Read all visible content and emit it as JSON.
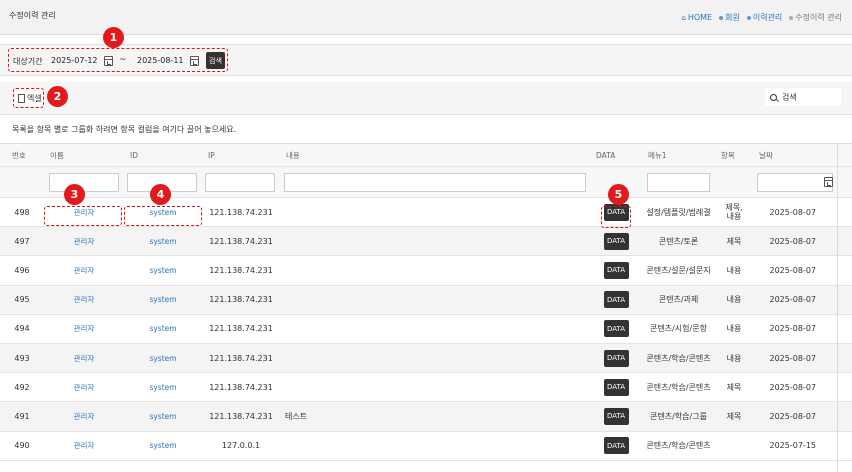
{
  "header": {
    "title": "수정이력 관리",
    "breadcrumb": [
      "HOME",
      "회원",
      "이력관리",
      "수정이력 관리"
    ]
  },
  "filter": {
    "period_label": "대상기간",
    "start_date": "2025-07-12",
    "separator": "~",
    "end_date": "2025-08-11",
    "search_label": "검색"
  },
  "toolbar": {
    "excel_label": "엑셀",
    "search_label": "검색"
  },
  "group_hint": "목록을 항목 별로 그룹화 하려면 항목 컬럼을 여기다 끌어 놓으세요.",
  "grid": {
    "headers": [
      "번호",
      "이름",
      "ID",
      "IP",
      "내용",
      "DATA",
      "메뉴1",
      "항목",
      "날짜"
    ],
    "rows": [
      {
        "no": "498",
        "name": "관리자",
        "id": "system",
        "ip": "121.138.74.231",
        "content": "",
        "data": "DATA",
        "menu": "설정/템플릿/범례결",
        "item": "제목, 내용",
        "date": "2025-08-07"
      },
      {
        "no": "497",
        "name": "관리자",
        "id": "system",
        "ip": "121.138.74.231",
        "content": "",
        "data": "DATA",
        "menu": "콘텐츠/토론",
        "item": "제목",
        "date": "2025-08-07"
      },
      {
        "no": "496",
        "name": "관리자",
        "id": "system",
        "ip": "121.138.74.231",
        "content": "",
        "data": "DATA",
        "menu": "콘텐츠/설문/설문지",
        "item": "내용",
        "date": "2025-08-07"
      },
      {
        "no": "495",
        "name": "관리자",
        "id": "system",
        "ip": "121.138.74.231",
        "content": "",
        "data": "DATA",
        "menu": "콘텐츠/과제",
        "item": "내용",
        "date": "2025-08-07"
      },
      {
        "no": "494",
        "name": "관리자",
        "id": "system",
        "ip": "121.138.74.231",
        "content": "",
        "data": "DATA",
        "menu": "콘텐츠/시험/문항",
        "item": "내용",
        "date": "2025-08-07"
      },
      {
        "no": "493",
        "name": "관리자",
        "id": "system",
        "ip": "121.138.74.231",
        "content": "",
        "data": "DATA",
        "menu": "콘텐츠/학습/콘텐츠",
        "item": "내용",
        "date": "2025-08-07"
      },
      {
        "no": "492",
        "name": "관리자",
        "id": "system",
        "ip": "121.138.74.231",
        "content": "",
        "data": "DATA",
        "menu": "콘텐츠/학습/콘텐츠",
        "item": "제목",
        "date": "2025-08-07"
      },
      {
        "no": "491",
        "name": "관리자",
        "id": "system",
        "ip": "121.138.74.231",
        "content": "테스트",
        "data": "DATA",
        "menu": "콘텐츠/학습/그룹",
        "item": "제목",
        "date": "2025-08-07"
      },
      {
        "no": "490",
        "name": "관리자",
        "id": "system",
        "ip": "127.0.0.1",
        "content": "",
        "data": "DATA",
        "menu": "콘텐츠/학습/콘텐츠",
        "item": "",
        "date": "2025-07-15"
      }
    ]
  },
  "annotations": [
    "1",
    "2",
    "3",
    "4",
    "5"
  ],
  "colors": {
    "accent": "#2f74c0",
    "marker": "#e21a1c",
    "dark_button": "#333333"
  }
}
